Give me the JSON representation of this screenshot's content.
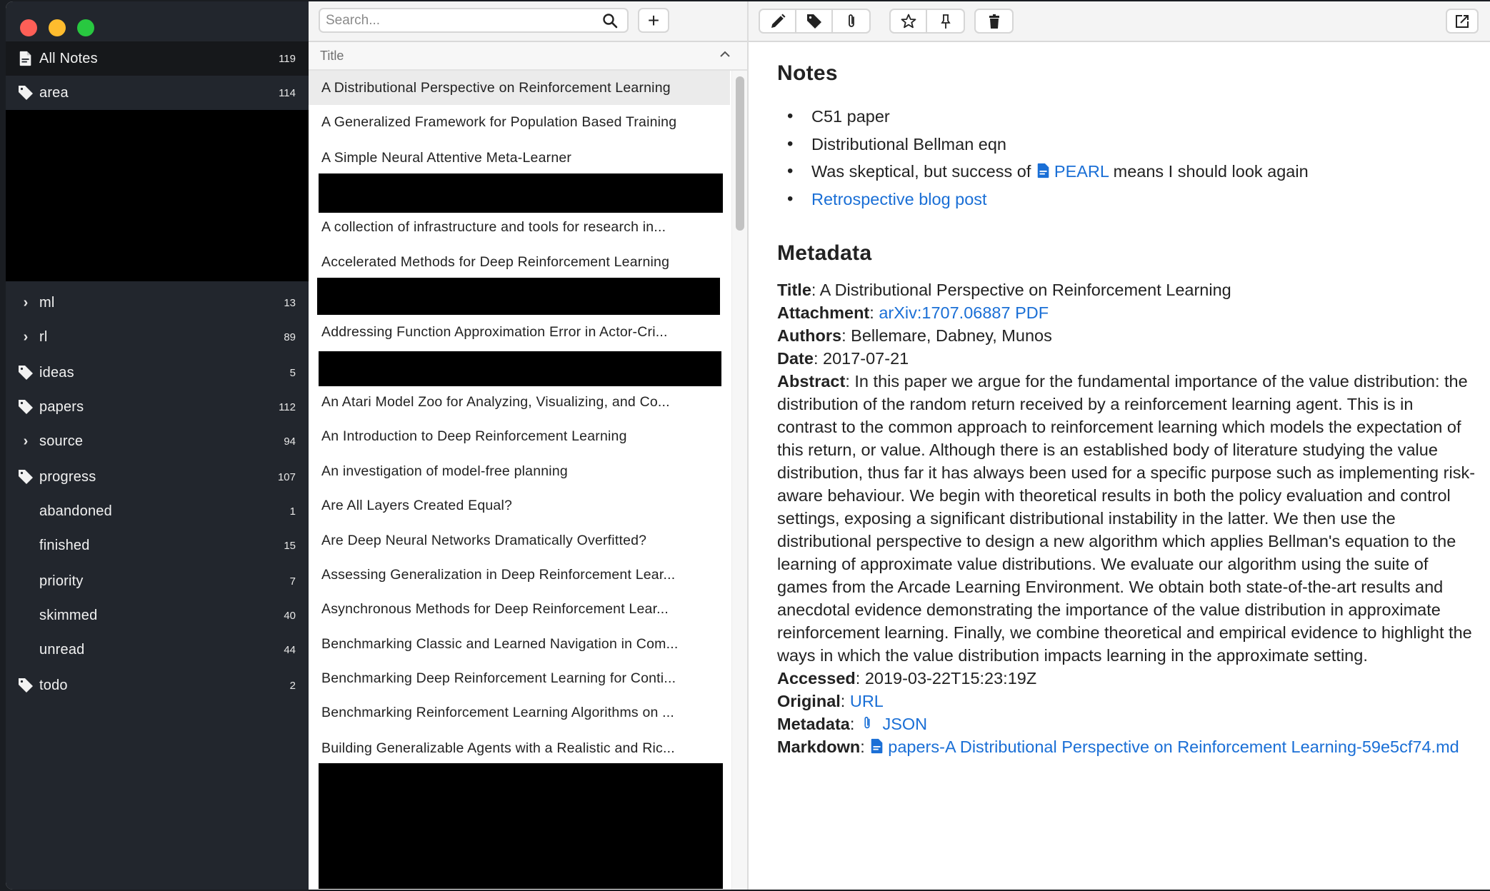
{
  "window": {
    "traffic_lights": [
      "close",
      "minimize",
      "maximize"
    ]
  },
  "sidebar": {
    "items": [
      {
        "label": "All Notes",
        "count": "119",
        "icon": "note-icon",
        "active": true
      },
      {
        "label": "area",
        "count": "114",
        "icon": "tag-icon"
      },
      {
        "label": "ml",
        "count": "13",
        "icon": "chevron-right-icon"
      },
      {
        "label": "rl",
        "count": "89",
        "icon": "chevron-right-icon"
      },
      {
        "label": "ideas",
        "count": "5",
        "icon": "tag-icon"
      },
      {
        "label": "papers",
        "count": "112",
        "icon": "tag-icon"
      },
      {
        "label": "source",
        "count": "94",
        "icon": "chevron-right-icon"
      },
      {
        "label": "progress",
        "count": "107",
        "icon": "tag-icon"
      },
      {
        "label": "abandoned",
        "count": "1",
        "icon": ""
      },
      {
        "label": "finished",
        "count": "15",
        "icon": ""
      },
      {
        "label": "priority",
        "count": "7",
        "icon": ""
      },
      {
        "label": "skimmed",
        "count": "40",
        "icon": ""
      },
      {
        "label": "unread",
        "count": "44",
        "icon": ""
      },
      {
        "label": "todo",
        "count": "2",
        "icon": "tag-icon"
      }
    ]
  },
  "note_list": {
    "search_placeholder": "Search...",
    "search_value": "",
    "add_label": "+",
    "column_header": "Title",
    "rows": [
      "A Distributional Perspective on Reinforcement Learning",
      "A Generalized Framework for Population Based Training",
      "A Simple Neural Attentive Meta-Learner",
      "A collection of infrastructure and tools for research in...",
      "Accelerated Methods for Deep Reinforcement Learning",
      "Addressing Function Approximation Error in Actor-Cri...",
      "An Atari Model Zoo for Analyzing, Visualizing, and Co...",
      "An Introduction to Deep Reinforcement Learning",
      "An investigation of model-free planning",
      "Are All Layers Created Equal?",
      "Are Deep Neural Networks Dramatically Overfitted?",
      "Assessing Generalization in Deep Reinforcement Lear...",
      "Asynchronous Methods for Deep Reinforcement Lear...",
      "Benchmarking Classic and Learned Navigation in Com...",
      "Benchmarking Deep Reinforcement Learning for Conti...",
      "Benchmarking Reinforcement Learning Algorithms on ...",
      "Building Generalizable Agents with a Realistic and Ric..."
    ],
    "selected_index": 0
  },
  "detail": {
    "toolbar": {
      "edit": "pencil-icon",
      "tag": "tag-icon",
      "attach": "paperclip-icon",
      "star": "star-icon",
      "pin": "pin-icon",
      "trash": "trash-icon",
      "popout": "external-link-icon"
    },
    "notes_heading": "Notes",
    "notes": {
      "item1": "C51 paper",
      "item2": "Distributional Bellman eqn",
      "item3_prefix": "Was skeptical, but success of ",
      "item3_link": "PEARL",
      "item3_suffix": " means I should look again",
      "item4_link": "Retrospective blog post"
    },
    "metadata_heading": "Metadata",
    "metadata": {
      "title_label": "Title",
      "title_value": "A Distributional Perspective on Reinforcement Learning",
      "attachment_label": "Attachment",
      "attachment_value": "arXiv:1707.06887 PDF",
      "authors_label": "Authors",
      "authors_value": "Bellemare, Dabney, Munos",
      "date_label": "Date",
      "date_value": "2017-07-21",
      "abstract_label": "Abstract",
      "abstract_value": "In this paper we argue for the fundamental importance of the value distri­bution: the distribution of the random return received by a reinforcement learning agent. This is in contrast to the common approach to reinforcement learning which models the expectation of this return, or value. Although there is an established body of literature studying the value distribution, thus far it has always been used for a specific purpose such as implementing risk-aware behaviour. We begin with theoret­ical results in both the policy evaluation and control settings, exposing a significant distributional instability in the latter. We then use the distributional perspective to design a new algorithm which applies Bellman's equation to the learning of approxim­ate value distributions. We evaluate our algorithm using the suite of games from the Arcade Learning Environment. We obtain both state-of-the-art results and anecdotal evidence demonstrating the importance of the value distribution in approximate rein­forcement learning. Finally, we combine theoretical and empirical evidence to high­light the ways in which the value distribution impacts learning in the approximate set­ting.",
      "accessed_label": "Accessed",
      "accessed_value": "2019-03-22T15:23:19Z",
      "original_label": "Original",
      "original_value": "URL",
      "metadata_label": "Metadata",
      "metadata_value": "JSON",
      "markdown_label": "Markdown",
      "markdown_value": "papers-A Distributional Perspective on Reinforcement Learning-59e5cf74.md"
    }
  },
  "colors": {
    "sidebar_bg": "#22262d",
    "sidebar_active_bg": "#16181b",
    "link": "#1a6fd6",
    "selected_row_bg": "#ebebeb"
  }
}
